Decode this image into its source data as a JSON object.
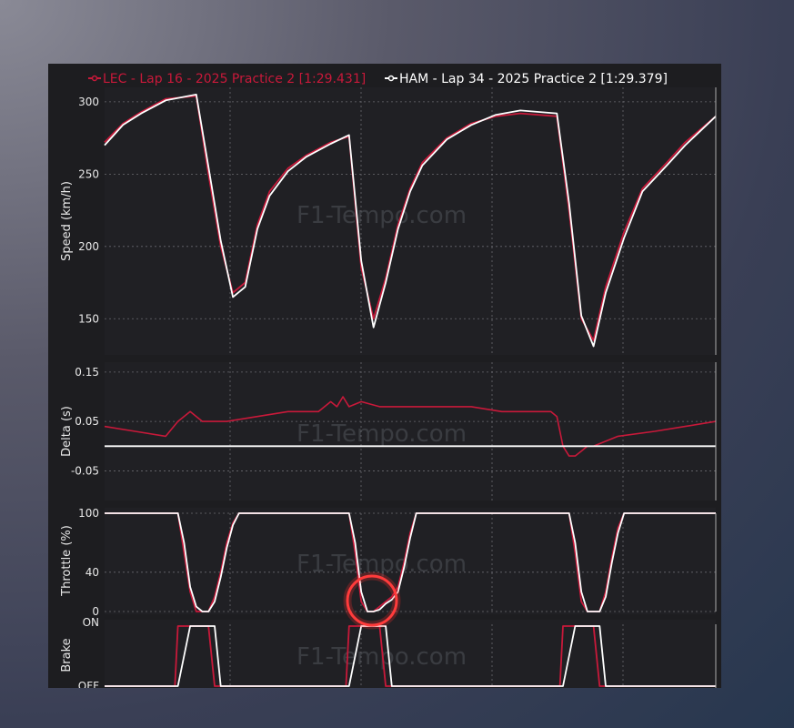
{
  "legend": {
    "lec": "LEC - Lap 16 - 2025 Practice 2 [1:29.431]",
    "ham": "HAM - Lap 34 - 2025 Practice 2 [1:29.379]"
  },
  "watermark": "F1-Tempo.com",
  "colors": {
    "lec": "#c8193a",
    "ham": "#ffffff",
    "highlight": "#ff2a2a"
  },
  "chart_data": [
    {
      "type": "line",
      "ylabel": "Speed (km/h)",
      "ylim": [
        125,
        310
      ],
      "yticks": [
        150,
        200,
        250,
        300
      ],
      "x": [
        0,
        3,
        6,
        10,
        15,
        17,
        19,
        21,
        23,
        25,
        27,
        30,
        33,
        37,
        40,
        42,
        44,
        46,
        48,
        50,
        52,
        56,
        60,
        64,
        68,
        74,
        76,
        78,
        80,
        82,
        85,
        88,
        92,
        95,
        100
      ],
      "series": [
        {
          "name": "LEC - Lap 16 - 2025 Practice 2 [1:29.431]",
          "values": [
            272,
            285,
            293,
            302,
            304,
            250,
            200,
            168,
            175,
            215,
            238,
            254,
            263,
            272,
            276,
            185,
            150,
            178,
            215,
            240,
            258,
            275,
            285,
            290,
            292,
            290,
            225,
            150,
            135,
            172,
            210,
            240,
            258,
            272,
            290
          ]
        },
        {
          "name": "HAM - Lap 34 - 2025 Practice 2 [1:29.379]",
          "values": [
            270,
            284,
            292,
            301,
            305,
            255,
            204,
            165,
            172,
            212,
            235,
            252,
            262,
            271,
            277,
            190,
            144,
            175,
            212,
            238,
            256,
            274,
            284,
            291,
            294,
            292,
            230,
            152,
            131,
            168,
            206,
            238,
            256,
            270,
            290
          ]
        }
      ]
    },
    {
      "type": "line",
      "ylabel": "Delta (s)",
      "ylim": [
        -0.11,
        0.17
      ],
      "yticks": [
        0.15,
        0.05,
        -0.05
      ],
      "x": [
        0,
        5,
        10,
        12,
        14,
        16,
        18,
        20,
        25,
        30,
        35,
        37,
        38,
        39,
        40,
        42,
        45,
        50,
        55,
        60,
        65,
        70,
        73,
        74,
        75,
        76,
        77,
        78,
        79,
        80,
        84,
        90,
        95,
        100
      ],
      "series": [
        {
          "name": "delta",
          "values": [
            0.04,
            0.03,
            0.02,
            0.05,
            0.07,
            0.05,
            0.05,
            0.05,
            0.06,
            0.07,
            0.07,
            0.09,
            0.08,
            0.1,
            0.08,
            0.09,
            0.08,
            0.08,
            0.08,
            0.08,
            0.07,
            0.07,
            0.07,
            0.06,
            0.0,
            -0.02,
            -0.02,
            -0.01,
            0.0,
            0.0,
            0.02,
            0.03,
            0.04,
            0.05
          ]
        },
        {
          "name": "reference",
          "values": [
            0,
            0
          ]
        }
      ]
    },
    {
      "type": "line",
      "ylabel": "Throttle (%)",
      "ylim": [
        0,
        100
      ],
      "yticks": [
        100,
        40,
        0
      ],
      "x": [
        0,
        12,
        13,
        14,
        15,
        16,
        17,
        18,
        19,
        20,
        21,
        22,
        23,
        40,
        41,
        42,
        43,
        44,
        45,
        46,
        47,
        48,
        49,
        50,
        51,
        52,
        76,
        77,
        78,
        79,
        80,
        81,
        82,
        83,
        84,
        85,
        100
      ],
      "series": [
        {
          "name": "LEC - Lap 16 - 2025 Practice 2 [1:29.431]",
          "values": [
            100,
            100,
            60,
            20,
            0,
            0,
            0,
            15,
            40,
            70,
            90,
            100,
            100,
            100,
            60,
            10,
            0,
            0,
            5,
            10,
            15,
            25,
            50,
            80,
            100,
            100,
            100,
            60,
            10,
            0,
            0,
            0,
            20,
            55,
            85,
            100,
            100
          ]
        },
        {
          "name": "HAM - Lap 34 - 2025 Practice 2 [1:29.379]",
          "values": [
            100,
            100,
            70,
            25,
            5,
            0,
            0,
            10,
            35,
            65,
            88,
            100,
            100,
            100,
            70,
            20,
            0,
            0,
            2,
            8,
            12,
            20,
            45,
            75,
            100,
            100,
            100,
            70,
            20,
            0,
            0,
            0,
            15,
            50,
            80,
            100,
            100
          ]
        }
      ]
    },
    {
      "type": "line",
      "ylabel": "Brake",
      "yticks": [
        "ON",
        "OFF"
      ],
      "ylim": [
        0,
        1
      ],
      "x": [
        0,
        11.5,
        12,
        14,
        15,
        16,
        17,
        18,
        19,
        39.5,
        40,
        42,
        43,
        44,
        45,
        46,
        47,
        74.5,
        75,
        77,
        78,
        79,
        80,
        81,
        82,
        100
      ],
      "series": [
        {
          "name": "LEC - Lap 16 - 2025 Practice 2 [1:29.431]",
          "values": [
            0,
            0,
            1,
            1,
            1,
            1,
            1,
            0,
            0,
            0,
            1,
            1,
            1,
            1,
            1,
            0,
            0,
            0,
            1,
            1,
            1,
            1,
            1,
            0,
            0,
            0
          ]
        },
        {
          "name": "HAM - Lap 34 - 2025 Practice 2 [1:29.379]",
          "values": [
            0,
            0,
            0,
            1,
            1,
            1,
            1,
            1,
            0,
            0,
            0,
            1,
            1,
            1,
            1,
            1,
            0,
            0,
            0,
            1,
            1,
            1,
            1,
            1,
            0,
            0
          ]
        }
      ]
    }
  ]
}
